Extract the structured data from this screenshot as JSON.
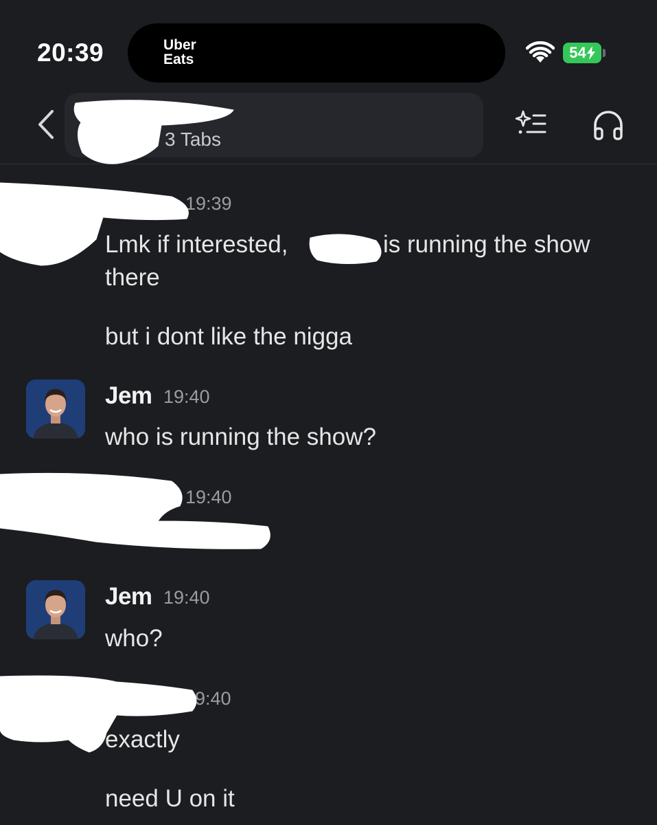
{
  "status_bar": {
    "time": "20:39",
    "live_activity_brand": "Uber\nEats",
    "battery_level": "54",
    "wifi_icon": "wifi-icon",
    "charging_icon": "bolt-icon"
  },
  "header": {
    "subtitle": "3 Tabs",
    "back_icon": "chevron-left-icon",
    "ai_icon": "sparkle-list-icon",
    "huddle_icon": "headphones-icon"
  },
  "messages": [
    {
      "id": "m1",
      "timestamp": "19:39",
      "text_part1": "Lmk if interested,",
      "text_part2": "is running the show",
      "text_part3": "there",
      "text_followup": "but i dont like the nigga"
    },
    {
      "id": "m2",
      "sender": "Jem",
      "timestamp": "19:40",
      "text": "who is running the show?"
    },
    {
      "id": "m3",
      "timestamp": "19:40"
    },
    {
      "id": "m4",
      "sender": "Jem",
      "timestamp": "19:40",
      "text": "who?"
    },
    {
      "id": "m5",
      "timestamp": "9:40",
      "text": "exactly",
      "text_followup": "need U on it"
    }
  ],
  "colors": {
    "background": "#1b1d21",
    "battery_green": "#35c759",
    "avatar_bg": "#1f3e78",
    "redaction": "#ffffff"
  }
}
